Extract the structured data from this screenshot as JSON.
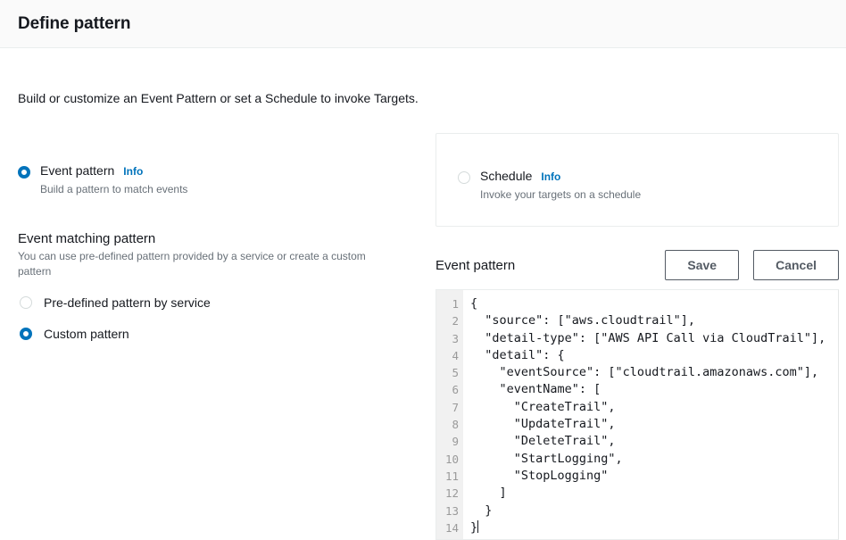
{
  "header": {
    "title": "Define pattern"
  },
  "intro": "Build or customize an Event Pattern or set a Schedule to invoke Targets.",
  "source_options": {
    "event_pattern": {
      "label": "Event pattern",
      "info_label": "Info",
      "description": "Build a pattern to match events",
      "selected": true
    },
    "schedule": {
      "label": "Schedule",
      "info_label": "Info",
      "description": "Invoke your targets on a schedule",
      "selected": false
    }
  },
  "event_matching": {
    "title": "Event matching pattern",
    "description": "You can use pre-defined pattern provided by a service or create a custom pattern",
    "options": [
      {
        "label": "Pre-defined pattern by service",
        "selected": false
      },
      {
        "label": "Custom pattern",
        "selected": true
      }
    ]
  },
  "editor_panel": {
    "title": "Event pattern",
    "save_label": "Save",
    "cancel_label": "Cancel",
    "line_numbers": [
      "1",
      "2",
      "3",
      "4",
      "5",
      "6",
      "7",
      "8",
      "9",
      "10",
      "11",
      "12",
      "13",
      "14"
    ],
    "code_lines": [
      "{",
      "  \"source\": [\"aws.cloudtrail\"],",
      "  \"detail-type\": [\"AWS API Call via CloudTrail\"],",
      "  \"detail\": {",
      "    \"eventSource\": [\"cloudtrail.amazonaws.com\"],",
      "    \"eventName\": [",
      "      \"CreateTrail\",",
      "      \"UpdateTrail\",",
      "      \"DeleteTrail\",",
      "      \"StartLogging\",",
      "      \"StopLogging\"",
      "    ]",
      "  }",
      "}"
    ]
  },
  "colors": {
    "accent_blue": "#0073bb",
    "text_primary": "#16191f",
    "text_secondary": "#687078",
    "border_light": "#eaeded",
    "button_border": "#545b64",
    "gutter_bg": "#f1f1f1",
    "header_bg": "#fafafa"
  }
}
